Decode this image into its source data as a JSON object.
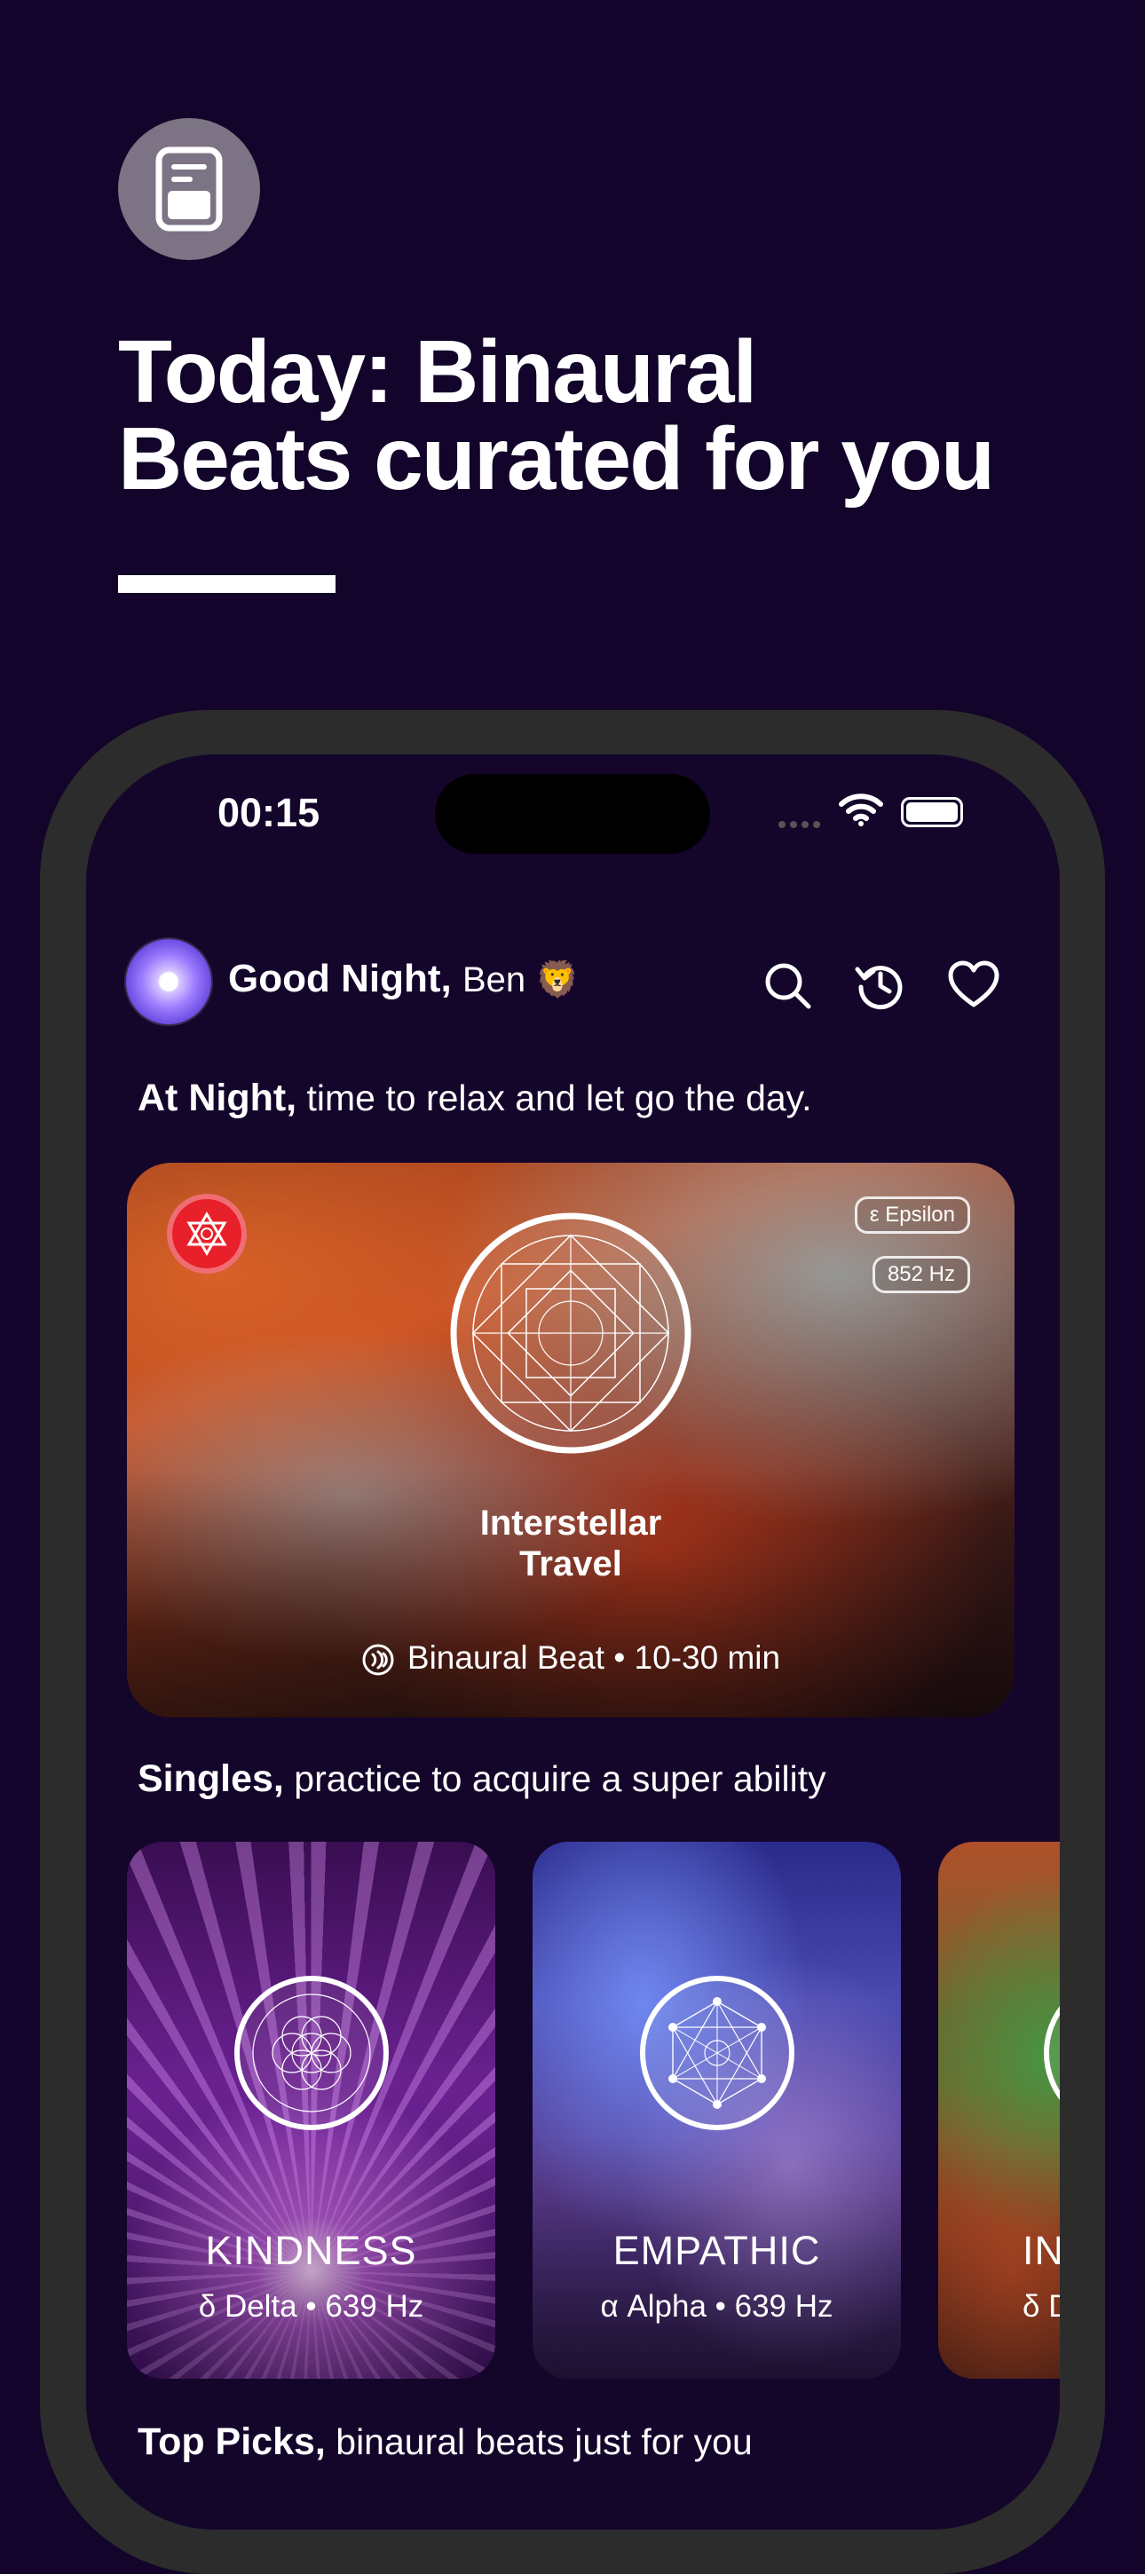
{
  "promo": {
    "icon": "document-icon",
    "headline_line1": "Today: Binaural",
    "headline_line2": "Beats curated for you"
  },
  "status_bar": {
    "time": "00:15"
  },
  "header": {
    "greeting": "Good Night,",
    "name": "Ben 🦁",
    "icons": [
      "search-icon",
      "history-icon",
      "heart-icon"
    ]
  },
  "section_night": {
    "title": "At Night,",
    "subtitle": " time to relax and let go the day."
  },
  "hero": {
    "title_line1": "Interstellar",
    "title_line2": "Travel",
    "tag_band": "ε Epsilon",
    "tag_freq": "852 Hz",
    "meta": "Binaural Beat • 10-30 min"
  },
  "section_singles": {
    "title": "Singles,",
    "subtitle": " practice to acquire a super ability"
  },
  "singles": [
    {
      "title": "KINDNESS",
      "subtitle": "δ Delta • 639 Hz"
    },
    {
      "title": "EMPATHIC",
      "subtitle": "α Alpha • 639 Hz"
    },
    {
      "title": "IN",
      "subtitle": "δ De"
    }
  ],
  "section_top": {
    "title": "Top Picks,",
    "subtitle": " binaural beats just for you"
  },
  "colors": {
    "background": "#12042a",
    "screen": "#14052b",
    "phone_frame": "#2c2c2c",
    "badge_red": "#e8202a"
  }
}
